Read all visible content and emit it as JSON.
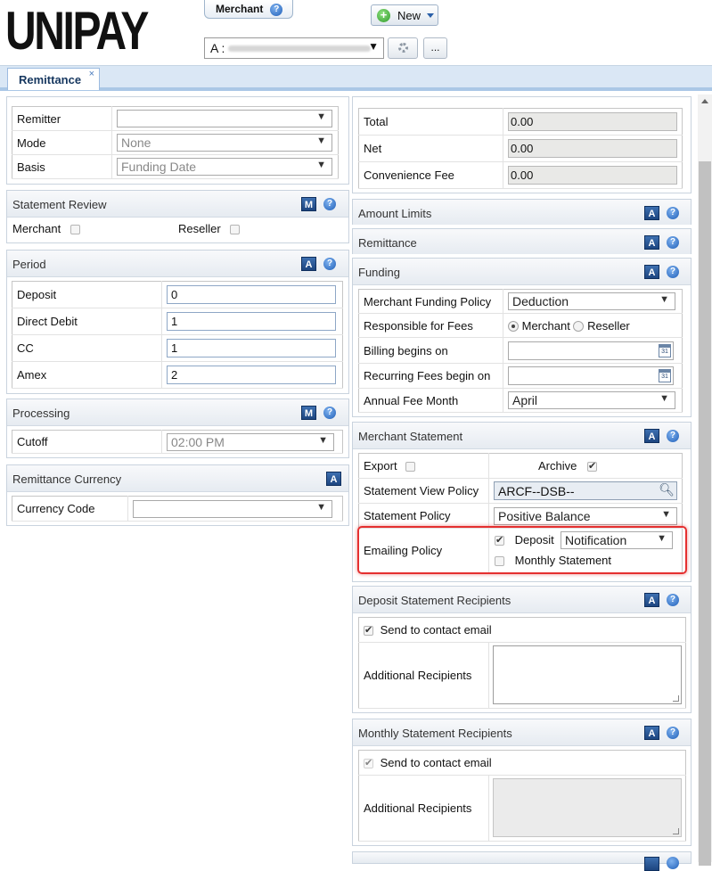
{
  "header": {
    "logo": "UNIPAY",
    "merchant_tab": "Merchant",
    "new_button": "New",
    "account_prefix": "A :",
    "more_button": "..."
  },
  "tabs": [
    {
      "label": "Remittance",
      "close": "×"
    }
  ],
  "left": {
    "top": {
      "rows": [
        {
          "label": "Remitter",
          "value": ""
        },
        {
          "label": "Mode",
          "value": "None"
        },
        {
          "label": "Basis",
          "value": "Funding Date"
        }
      ]
    },
    "statement_review": {
      "title": "Statement Review",
      "badge": "M",
      "merchant_label": "Merchant",
      "reseller_label": "Reseller"
    },
    "period": {
      "title": "Period",
      "badge": "A",
      "rows": [
        {
          "label": "Deposit",
          "value": "0"
        },
        {
          "label": "Direct Debit",
          "value": "1"
        },
        {
          "label": "CC",
          "value": "1"
        },
        {
          "label": "Amex",
          "value": "2"
        }
      ]
    },
    "processing": {
      "title": "Processing",
      "badge": "M",
      "cutoff_label": "Cutoff",
      "cutoff_value": "02:00 PM"
    },
    "currency": {
      "title": "Remittance Currency",
      "badge": "A",
      "label": "Currency Code",
      "value": ""
    }
  },
  "right": {
    "totals": {
      "rows": [
        {
          "label": "Total",
          "value": "0.00"
        },
        {
          "label": "Net",
          "value": "0.00"
        },
        {
          "label": "Convenience Fee",
          "value": "0.00"
        }
      ]
    },
    "amount_limits": {
      "title": "Amount Limits",
      "badge": "A"
    },
    "remittance": {
      "title": "Remittance",
      "badge": "A"
    },
    "funding": {
      "title": "Funding",
      "badge": "A",
      "policy_label": "Merchant Funding Policy",
      "policy_value": "Deduction",
      "fees_label": "Responsible for Fees",
      "fees_merchant": "Merchant",
      "fees_reseller": "Reseller",
      "billing_label": "Billing begins on",
      "recurring_label": "Recurring Fees begin on",
      "annual_label": "Annual Fee Month",
      "annual_value": "April",
      "calendar_day": "31"
    },
    "merchant_statement": {
      "title": "Merchant Statement",
      "badge": "A",
      "export_label": "Export",
      "archive_label": "Archive",
      "view_policy_label": "Statement View Policy",
      "view_policy_value": "ARCF--DSB--",
      "statement_policy_label": "Statement Policy",
      "statement_policy_value": "Positive Balance",
      "emailing_label": "Emailing Policy",
      "deposit_label": "Deposit",
      "deposit_select": "Notification",
      "monthly_label": "Monthly Statement"
    },
    "deposit_recipients": {
      "title": "Deposit Statement Recipients",
      "badge": "A",
      "send_label": "Send to contact email",
      "additional_label": "Additional Recipients"
    },
    "monthly_recipients": {
      "title": "Monthly Statement Recipients",
      "badge": "A",
      "send_label": "Send to contact email",
      "additional_label": "Additional Recipients"
    }
  }
}
